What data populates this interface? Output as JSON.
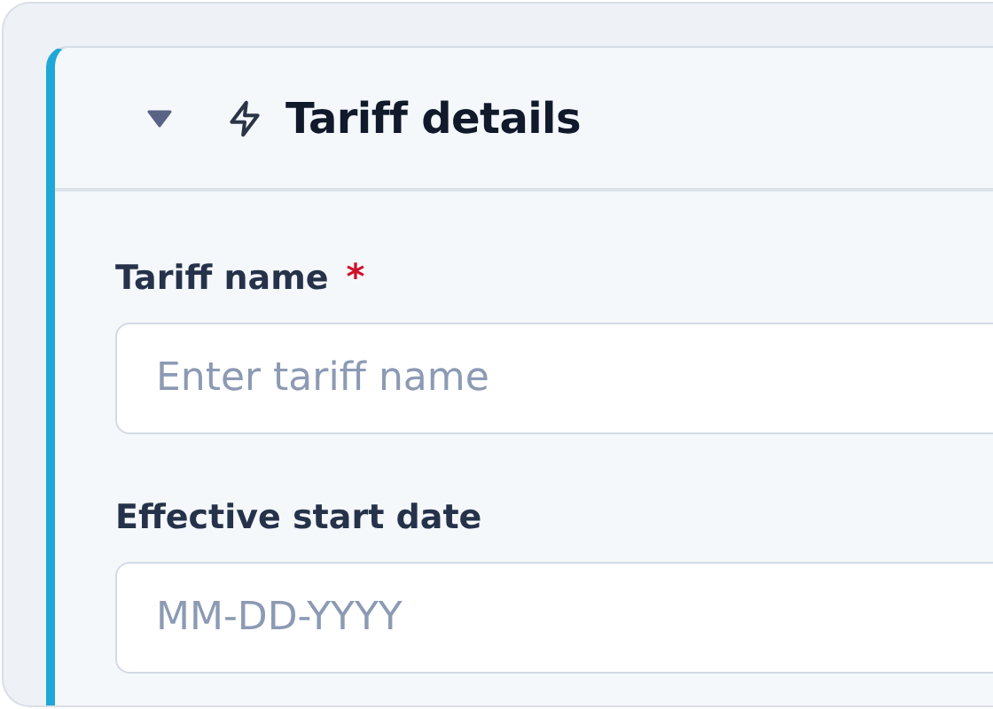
{
  "section": {
    "title": "Tariff details",
    "expanded": true
  },
  "fields": [
    {
      "label": "Tariff name",
      "required_mark": "*",
      "placeholder": "Enter tariff name"
    },
    {
      "label": "Effective start date",
      "placeholder": "MM-DD-YYYY"
    }
  ]
}
